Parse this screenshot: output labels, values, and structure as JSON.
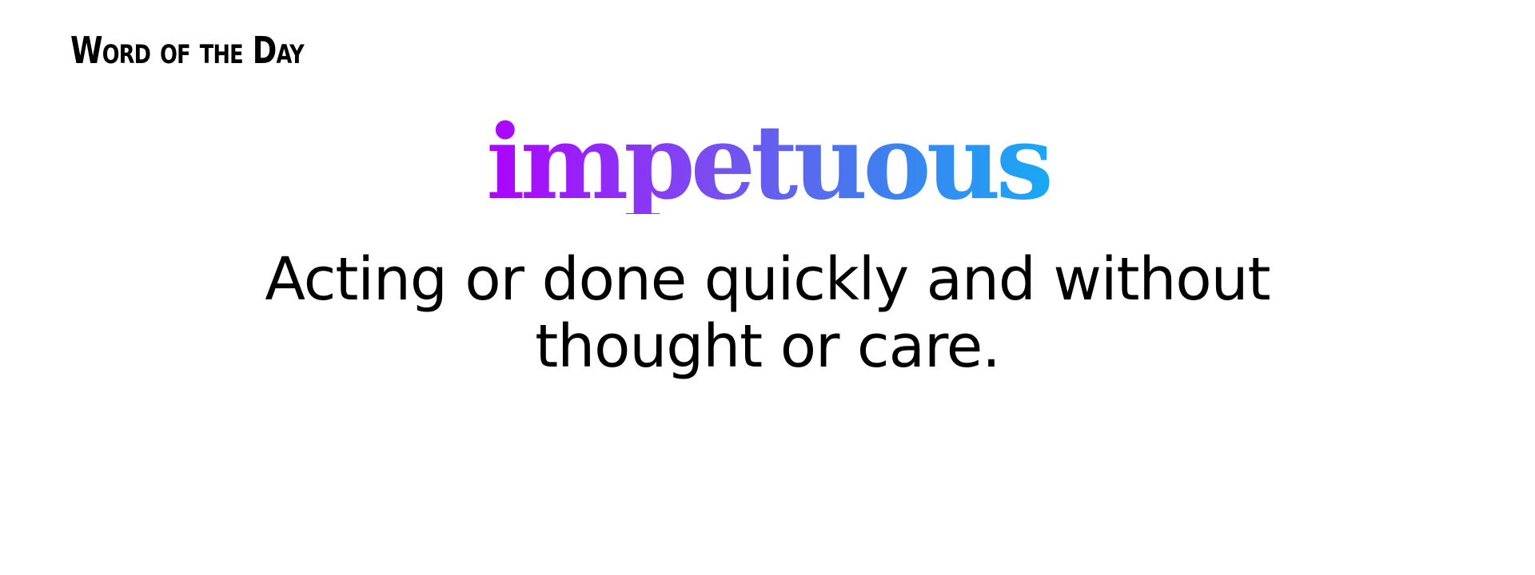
{
  "header": {
    "label": "Word of the Day"
  },
  "word": {
    "text": "impetuous",
    "gradient_start": "#b000ff",
    "gradient_end": "#18aaf5"
  },
  "definition": {
    "text": "Acting or done quickly and without thought or care."
  }
}
